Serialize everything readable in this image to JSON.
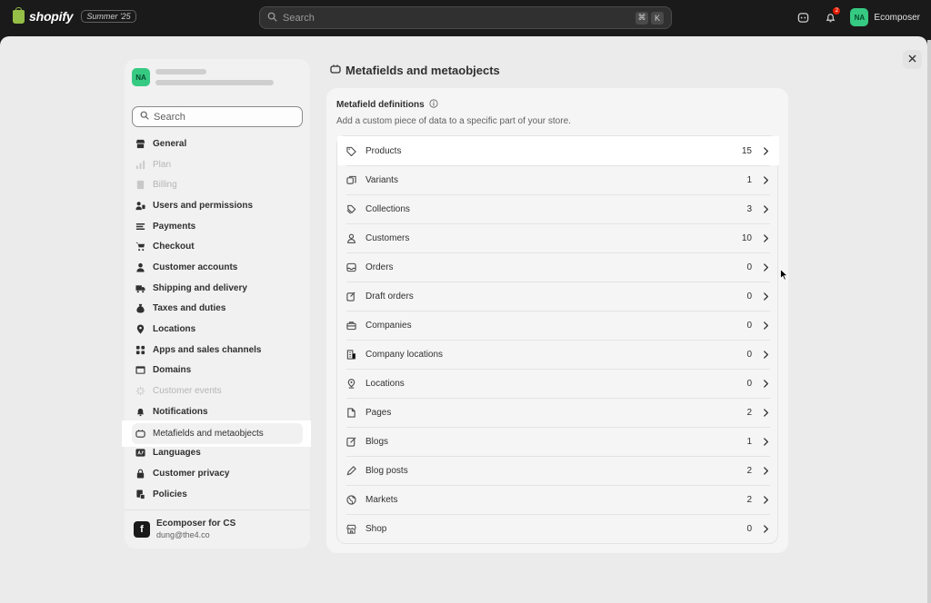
{
  "topbar": {
    "brand": "shopify",
    "edition": "Summer '25",
    "search_placeholder": "Search",
    "shortcut_keys": [
      "⌘",
      "K"
    ],
    "notification_count": "2",
    "user_initials": "NA",
    "user_name": "Ecomposer"
  },
  "sidebar": {
    "store_initials": "NA",
    "search_placeholder": "Search",
    "items": [
      {
        "label": "General",
        "icon": "store-icon",
        "disabled": false
      },
      {
        "label": "Plan",
        "icon": "chart-icon",
        "disabled": true
      },
      {
        "label": "Billing",
        "icon": "billing-icon",
        "disabled": true
      },
      {
        "label": "Users and permissions",
        "icon": "users-icon",
        "disabled": false
      },
      {
        "label": "Payments",
        "icon": "payments-icon",
        "disabled": false
      },
      {
        "label": "Checkout",
        "icon": "cart-icon",
        "disabled": false
      },
      {
        "label": "Customer accounts",
        "icon": "person-icon",
        "disabled": false
      },
      {
        "label": "Shipping and delivery",
        "icon": "truck-icon",
        "disabled": false
      },
      {
        "label": "Taxes and duties",
        "icon": "tax-icon",
        "disabled": false
      },
      {
        "label": "Locations",
        "icon": "location-icon",
        "disabled": false
      },
      {
        "label": "Apps and sales channels",
        "icon": "apps-icon",
        "disabled": false
      },
      {
        "label": "Domains",
        "icon": "domain-icon",
        "disabled": false
      },
      {
        "label": "Customer events",
        "icon": "events-icon",
        "disabled": true
      },
      {
        "label": "Notifications",
        "icon": "bell-icon",
        "disabled": false
      },
      {
        "label": "Metafields and metaobjects",
        "icon": "metafield-icon",
        "disabled": false,
        "selected": true
      },
      {
        "label": "Languages",
        "icon": "language-icon",
        "disabled": false
      },
      {
        "label": "Customer privacy",
        "icon": "lock-icon",
        "disabled": false
      },
      {
        "label": "Policies",
        "icon": "policy-icon",
        "disabled": false
      }
    ],
    "footer": {
      "logo_letter": "f",
      "name": "Ecomposer for CS",
      "email": "dung@the4.co"
    }
  },
  "main": {
    "page_title": "Metafields and metaobjects",
    "card_title": "Metafield definitions",
    "card_subtitle": "Add a custom piece of data to a specific part of your store.",
    "rows": [
      {
        "label": "Products",
        "count": "15",
        "icon": "tag-icon"
      },
      {
        "label": "Variants",
        "count": "1",
        "icon": "variants-icon"
      },
      {
        "label": "Collections",
        "count": "3",
        "icon": "collections-icon"
      },
      {
        "label": "Customers",
        "count": "10",
        "icon": "person-icon"
      },
      {
        "label": "Orders",
        "count": "0",
        "icon": "inbox-icon"
      },
      {
        "label": "Draft orders",
        "count": "0",
        "icon": "draft-icon"
      },
      {
        "label": "Companies",
        "count": "0",
        "icon": "briefcase-icon"
      },
      {
        "label": "Company locations",
        "count": "0",
        "icon": "building-icon"
      },
      {
        "label": "Locations",
        "count": "0",
        "icon": "location-icon"
      },
      {
        "label": "Pages",
        "count": "2",
        "icon": "page-icon"
      },
      {
        "label": "Blogs",
        "count": "1",
        "icon": "blog-icon"
      },
      {
        "label": "Blog posts",
        "count": "2",
        "icon": "pen-icon"
      },
      {
        "label": "Markets",
        "count": "2",
        "icon": "globe-icon"
      },
      {
        "label": "Shop",
        "count": "0",
        "icon": "shop-icon"
      }
    ]
  }
}
